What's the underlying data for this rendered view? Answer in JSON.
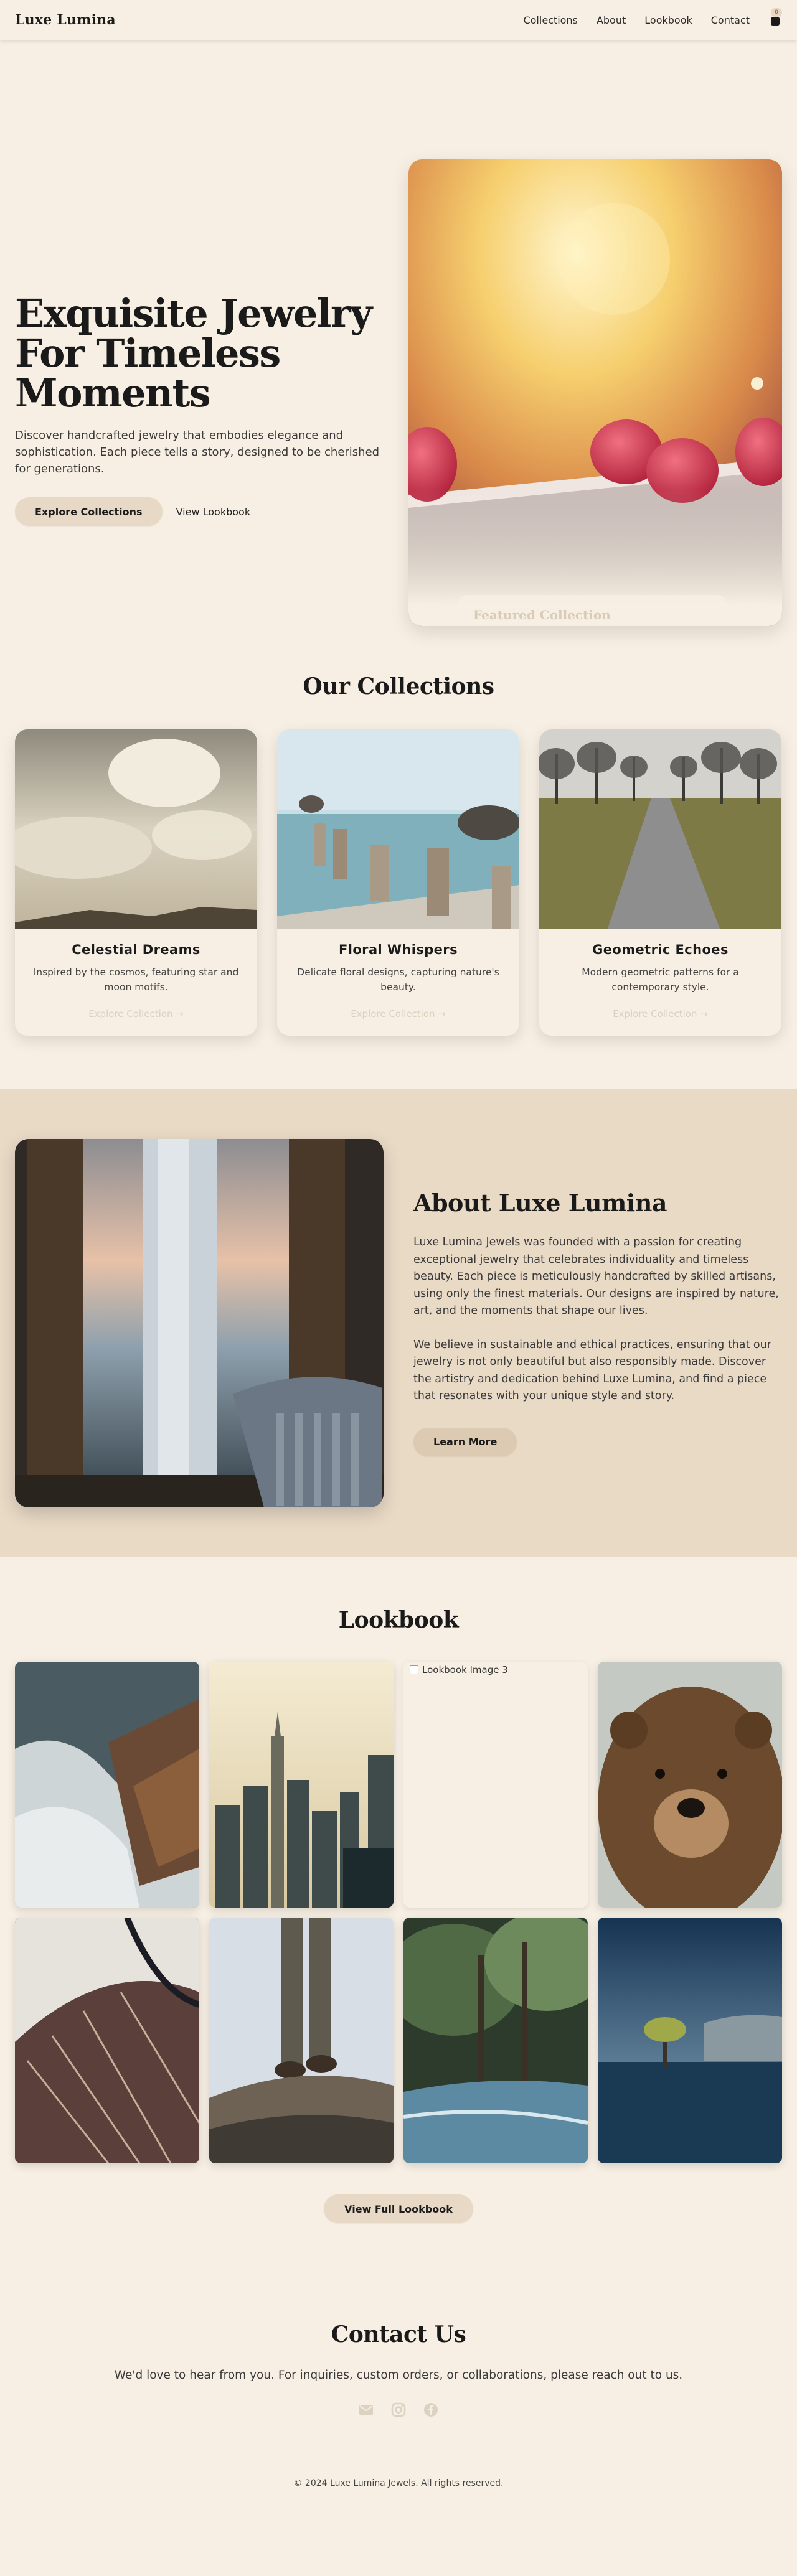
{
  "nav": {
    "brand": "Luxe Lumina",
    "links": [
      "Collections",
      "About",
      "Lookbook",
      "Contact"
    ],
    "cart_count": "0"
  },
  "hero": {
    "title_line1": "Exquisite Jewelry",
    "title_line2": "For Timeless Moments",
    "subtitle": "Discover handcrafted jewelry that embodies elegance and sophistication. Each piece tells a story, designed to be cherished for generations.",
    "primary_cta": "Explore Collections",
    "secondary_cta": "View Lookbook",
    "featured_label": "Featured Collection"
  },
  "collections": {
    "title": "Our Collections",
    "items": [
      {
        "name": "Celestial Dreams",
        "desc": "Inspired by the cosmos, featuring star and moon motifs.",
        "link": "Explore Collection →"
      },
      {
        "name": "Floral Whispers",
        "desc": "Delicate floral designs, capturing nature's beauty.",
        "link": "Explore Collection →"
      },
      {
        "name": "Geometric Echoes",
        "desc": "Modern geometric patterns for a contemporary style.",
        "link": "Explore Collection →"
      }
    ]
  },
  "about": {
    "title": "About Luxe Lumina",
    "p1": "Luxe Lumina Jewels was founded with a passion for creating exceptional jewelry that celebrates individuality and timeless beauty. Each piece is meticulously handcrafted by skilled artisans, using only the finest materials. Our designs are inspired by nature, art, and the moments that shape our lives.",
    "p2": "We believe in sustainable and ethical practices, ensuring that our jewelry is not only beautiful but also responsibly made. Discover the artistry and dedication behind Luxe Lumina, and find a piece that resonates with your unique style and story.",
    "cta": "Learn More"
  },
  "lookbook": {
    "title": "Lookbook",
    "broken_alt": "Lookbook Image 3",
    "cta": "View Full Lookbook"
  },
  "contact": {
    "title": "Contact Us",
    "text": "We'd love to hear from you. For inquiries, custom orders, or collaborations, please reach out to us.",
    "social_icons": [
      "mail-icon",
      "instagram-icon",
      "facebook-icon"
    ],
    "copyright": "© 2024 Luxe Lumina Jewels. All rights reserved."
  },
  "colors": {
    "background": "#f7efe3",
    "accent": "#e8d9c6",
    "about_background": "#e9dac6"
  }
}
